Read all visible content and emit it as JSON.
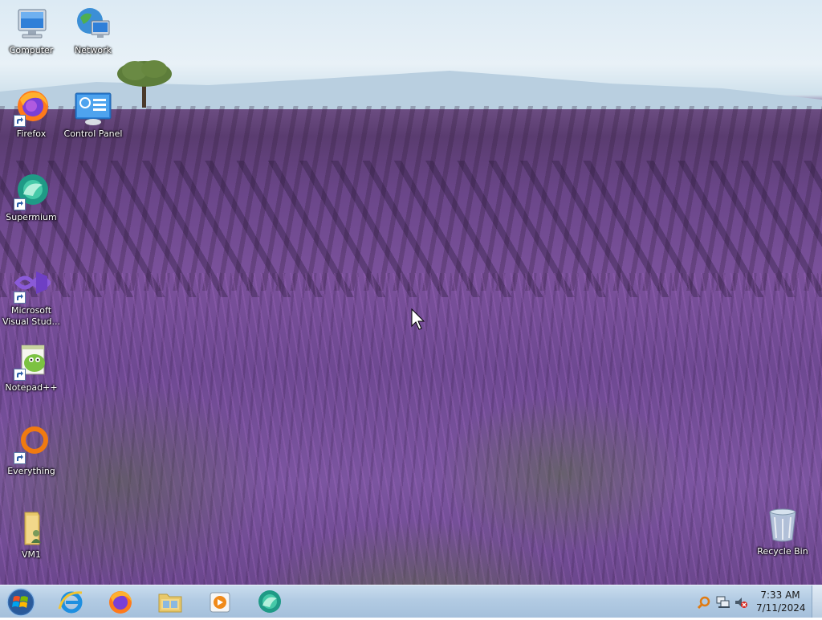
{
  "desktop": {
    "icons": [
      {
        "label": "Computer",
        "icon": "computer-icon"
      },
      {
        "label": "Network",
        "icon": "network-icon"
      },
      {
        "label": "Firefox",
        "icon": "firefox-icon"
      },
      {
        "label": "Control Panel",
        "icon": "control-panel-icon"
      },
      {
        "label": "Supermium",
        "icon": "supermium-icon"
      },
      {
        "label": "Microsoft\nVisual Stud...",
        "icon": "visual-studio-icon"
      },
      {
        "label": "Notepad++",
        "icon": "notepadpp-icon"
      },
      {
        "label": "Everything",
        "icon": "everything-icon"
      },
      {
        "label": "VM1",
        "icon": "folder-user-icon"
      },
      {
        "label": "Recycle Bin",
        "icon": "recycle-bin-icon"
      }
    ]
  },
  "taskbar": {
    "pinned": [
      {
        "name": "Internet Explorer",
        "icon": "ie-icon"
      },
      {
        "name": "Firefox",
        "icon": "firefox-icon"
      },
      {
        "name": "Windows Explorer",
        "icon": "explorer-icon"
      },
      {
        "name": "Windows Media Player",
        "icon": "media-player-icon"
      },
      {
        "name": "Supermium",
        "icon": "supermium-icon"
      }
    ],
    "tray": {
      "icons": [
        "search-tray-icon",
        "network-tray-icon",
        "volume-muted-icon"
      ],
      "time": "7:33 AM",
      "date": "7/11/2024"
    }
  },
  "colors": {
    "taskbar": "#b2cbe3",
    "lavender": "#7a519b",
    "sky": "#dceaf4"
  }
}
